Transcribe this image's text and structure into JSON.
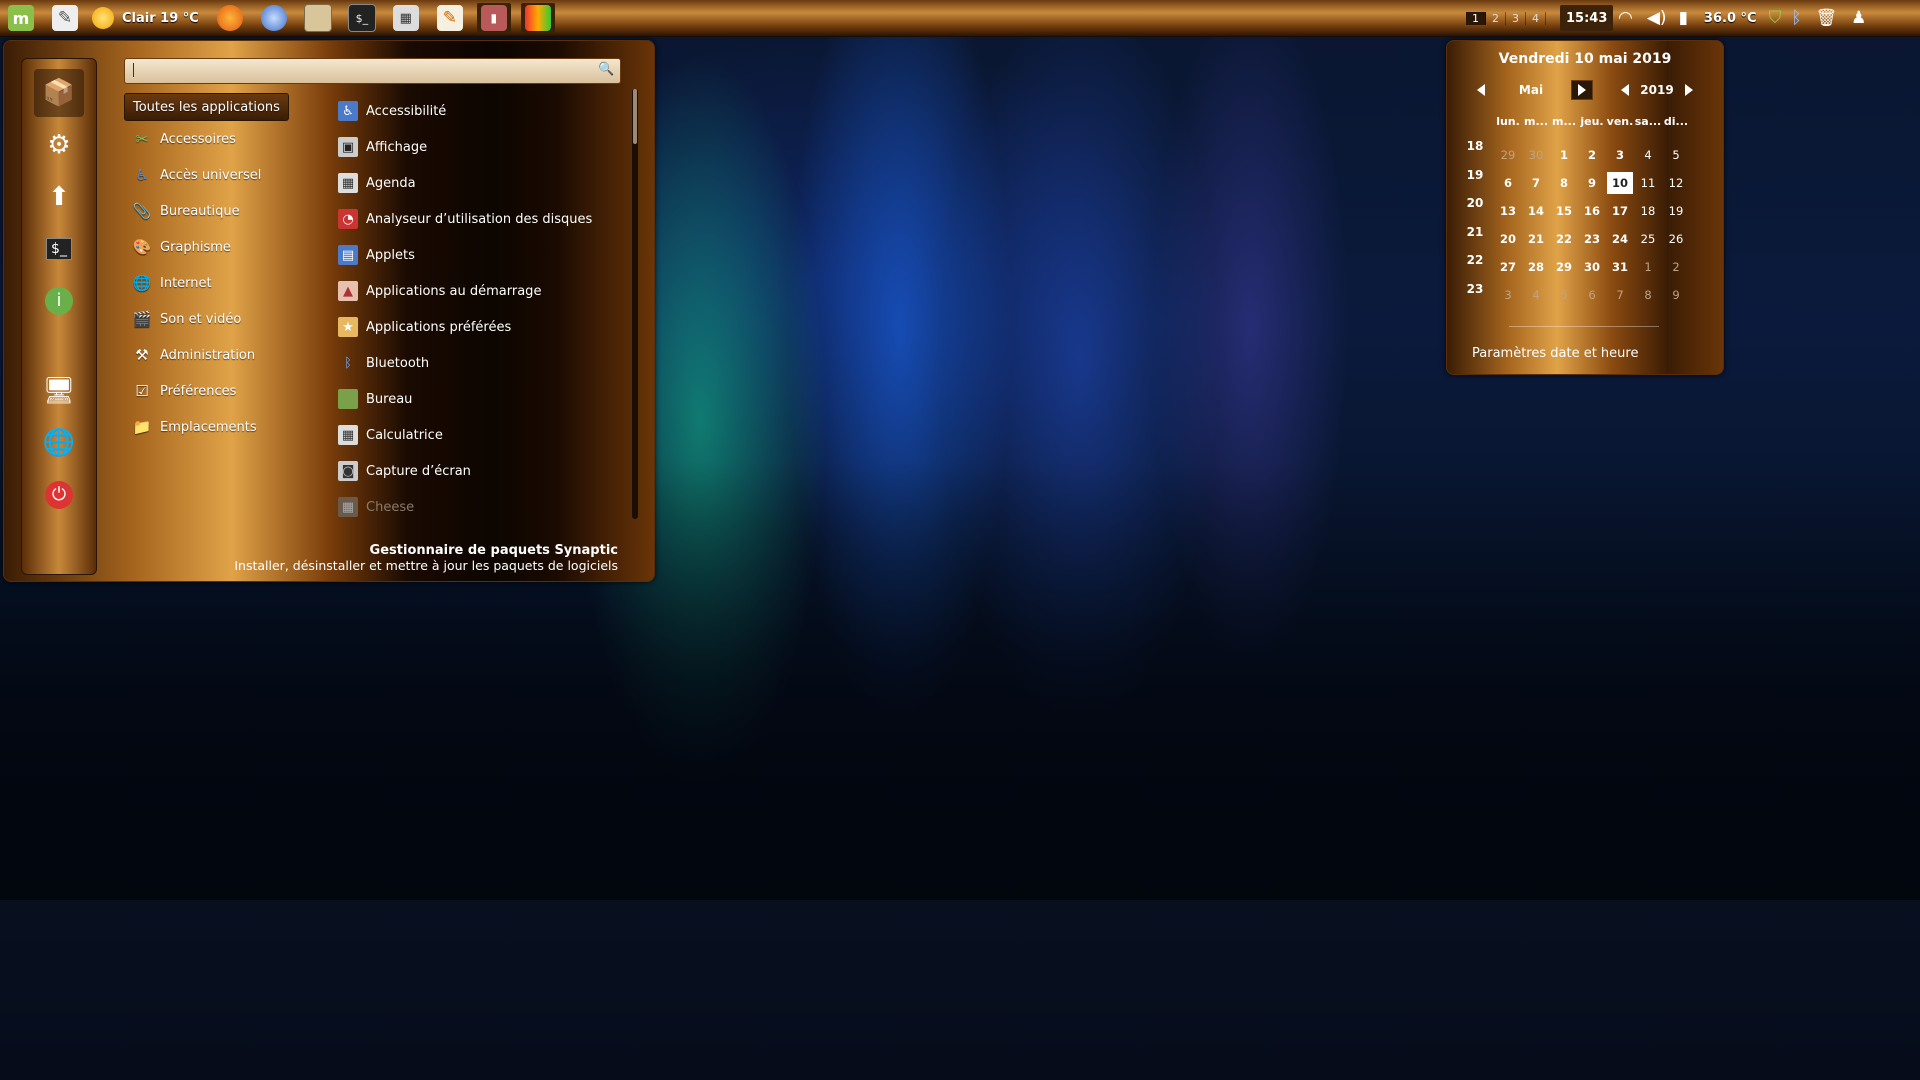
{
  "panel": {
    "weather": "Clair 19 °C",
    "workspaces": [
      "1",
      "2",
      "3",
      "4"
    ],
    "active_workspace": "1",
    "clock": "15:43",
    "temperature": "36.0 °C",
    "launchers": [
      "mint-menu-icon",
      "text-editor-icon",
      "firefox-icon",
      "thunderbird-icon",
      "files-icon",
      "terminal-icon",
      "calculator-icon",
      "notes-icon",
      "synaptic-icon",
      "monitor-icon"
    ],
    "tray": [
      "wifi-icon",
      "volume-icon",
      "battery-icon",
      "shield-icon",
      "bluetooth-icon",
      "trash-icon",
      "user-icon"
    ]
  },
  "menu": {
    "search": {
      "value": "",
      "placeholder": ""
    },
    "categories": [
      {
        "label": "Toutes les applications",
        "icon": "all-icon"
      },
      {
        "label": "Accessoires",
        "icon": "accessories-icon"
      },
      {
        "label": "Accès universel",
        "icon": "accessibility-icon"
      },
      {
        "label": "Bureautique",
        "icon": "office-icon"
      },
      {
        "label": "Graphisme",
        "icon": "graphics-icon"
      },
      {
        "label": "Internet",
        "icon": "internet-icon"
      },
      {
        "label": "Son et vidéo",
        "icon": "multimedia-icon"
      },
      {
        "label": "Administration",
        "icon": "admin-icon"
      },
      {
        "label": "Préférences",
        "icon": "preferences-icon"
      },
      {
        "label": "Emplacements",
        "icon": "folder-icon"
      }
    ],
    "apps": [
      {
        "label": "Accessibilité",
        "icon": "accessibility-icon"
      },
      {
        "label": "Affichage",
        "icon": "display-icon"
      },
      {
        "label": "Agenda",
        "icon": "calendar-icon"
      },
      {
        "label": "Analyseur d’utilisation des disques",
        "icon": "disk-usage-icon"
      },
      {
        "label": "Applets",
        "icon": "applets-icon"
      },
      {
        "label": "Applications au démarrage",
        "icon": "startup-icon"
      },
      {
        "label": "Applications préférées",
        "icon": "preferred-apps-icon"
      },
      {
        "label": "Bluetooth",
        "icon": "bluetooth-icon"
      },
      {
        "label": "Bureau",
        "icon": "desktop-icon"
      },
      {
        "label": "Calculatrice",
        "icon": "calculator-icon"
      },
      {
        "label": "Capture d’écran",
        "icon": "screenshot-icon"
      },
      {
        "label": "Cheese",
        "icon": "cheese-icon"
      }
    ],
    "favorites": [
      "synaptic-icon",
      "system-tools-icon",
      "update-icon",
      "terminal-icon",
      "info-icon",
      "display-icon",
      "network-icon",
      "power-icon"
    ],
    "description_title": "Gestionnaire de paquets Synaptic",
    "description_text": "Installer, désinstaller et mettre à jour les paquets de logiciels"
  },
  "calendar": {
    "title": "Vendredi 10 mai 2019",
    "month": "Mai",
    "year": "2019",
    "weekday_headers": [
      "lun.",
      "m...",
      "m...",
      "jeu.",
      "ven.",
      "sa...",
      "di..."
    ],
    "week_numbers": [
      "18",
      "19",
      "20",
      "21",
      "22",
      "23"
    ],
    "weeks": [
      [
        "29",
        "30",
        "1",
        "2",
        "3",
        "4",
        "5"
      ],
      [
        "6",
        "7",
        "8",
        "9",
        "10",
        "11",
        "12"
      ],
      [
        "13",
        "14",
        "15",
        "16",
        "17",
        "18",
        "19"
      ],
      [
        "20",
        "21",
        "22",
        "23",
        "24",
        "25",
        "26"
      ],
      [
        "27",
        "28",
        "29",
        "30",
        "31",
        "1",
        "2"
      ],
      [
        "3",
        "4",
        "5",
        "6",
        "7",
        "8",
        "9"
      ]
    ],
    "today": "10",
    "settings_link": "Paramètres date et heure"
  },
  "colors": {
    "accent": "#e0a348",
    "panel_dark": "#2b1706"
  }
}
